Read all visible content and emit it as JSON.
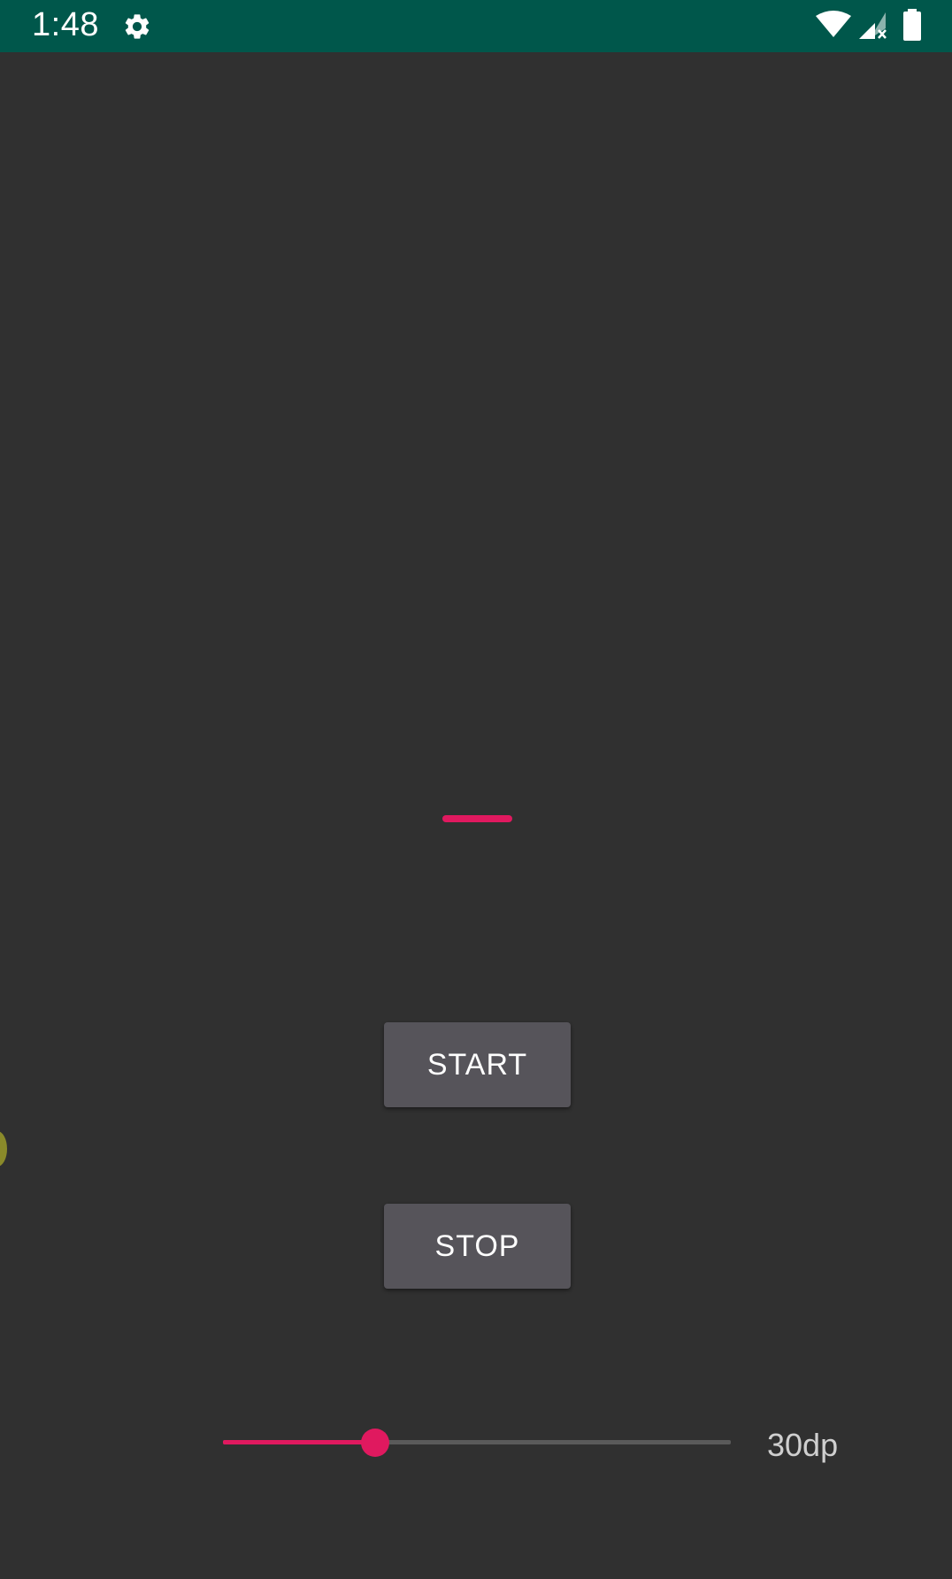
{
  "status_bar": {
    "time": "1:48",
    "background": "#00574b",
    "icons": [
      "settings-gear-icon",
      "wifi-icon",
      "signal-no-service-icon",
      "battery-icon"
    ]
  },
  "progress_indicator": {
    "color": "#e0195f"
  },
  "buttons": {
    "start_label": "START",
    "stop_label": "STOP"
  },
  "slider": {
    "value_label": "30dp",
    "fraction": 0.3,
    "active_color": "#e0195f",
    "track_color": "#5a5a5a"
  },
  "theme": {
    "background": "#303030",
    "button_color": "#56545a"
  }
}
